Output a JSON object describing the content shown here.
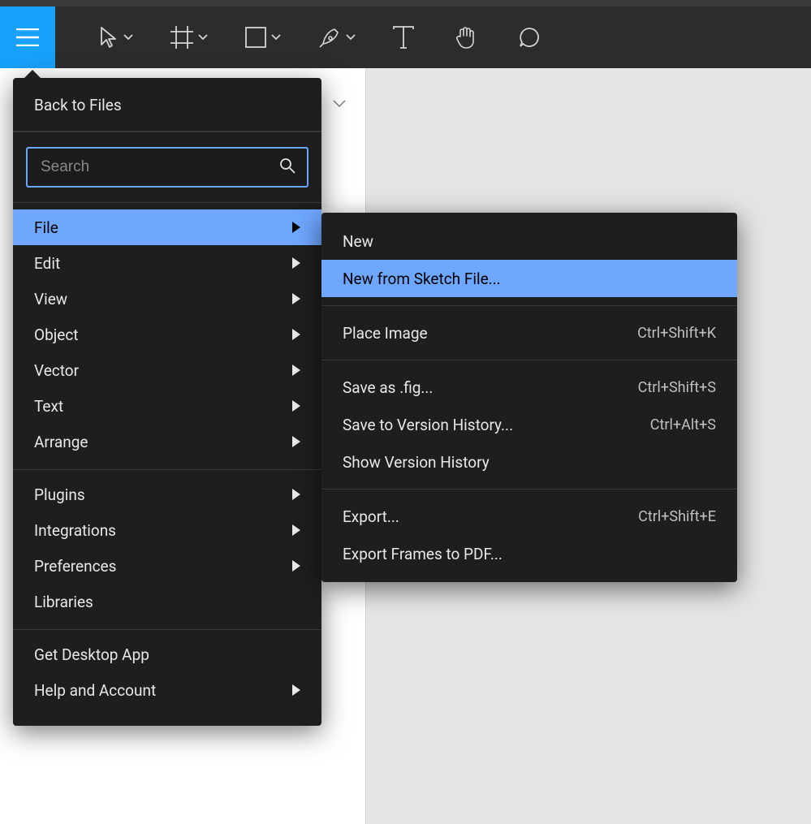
{
  "colors": {
    "accent": "#6fa7ff",
    "hamburger_bg": "#18a0fb"
  },
  "toolbar": {
    "tools": [
      "move",
      "frame",
      "rectangle",
      "pen",
      "text",
      "hand",
      "comment"
    ]
  },
  "menu": {
    "back_label": "Back to Files",
    "search_placeholder": "Search",
    "groups": [
      [
        {
          "label": "File",
          "submenu": true,
          "active": true
        },
        {
          "label": "Edit",
          "submenu": true
        },
        {
          "label": "View",
          "submenu": true
        },
        {
          "label": "Object",
          "submenu": true
        },
        {
          "label": "Vector",
          "submenu": true
        },
        {
          "label": "Text",
          "submenu": true
        },
        {
          "label": "Arrange",
          "submenu": true
        }
      ],
      [
        {
          "label": "Plugins",
          "submenu": true
        },
        {
          "label": "Integrations",
          "submenu": true
        },
        {
          "label": "Preferences",
          "submenu": true
        },
        {
          "label": "Libraries",
          "submenu": false
        }
      ],
      [
        {
          "label": "Get Desktop App",
          "submenu": false
        },
        {
          "label": "Help and Account",
          "submenu": true
        }
      ]
    ]
  },
  "submenu": {
    "groups": [
      [
        {
          "label": "New"
        },
        {
          "label": "New from Sketch File...",
          "active": true
        }
      ],
      [
        {
          "label": "Place Image",
          "shortcut": "Ctrl+Shift+K"
        }
      ],
      [
        {
          "label": "Save as .fig...",
          "shortcut": "Ctrl+Shift+S"
        },
        {
          "label": "Save to Version History...",
          "shortcut": "Ctrl+Alt+S"
        },
        {
          "label": "Show Version History"
        }
      ],
      [
        {
          "label": "Export...",
          "shortcut": "Ctrl+Shift+E"
        },
        {
          "label": "Export Frames to PDF..."
        }
      ]
    ]
  }
}
